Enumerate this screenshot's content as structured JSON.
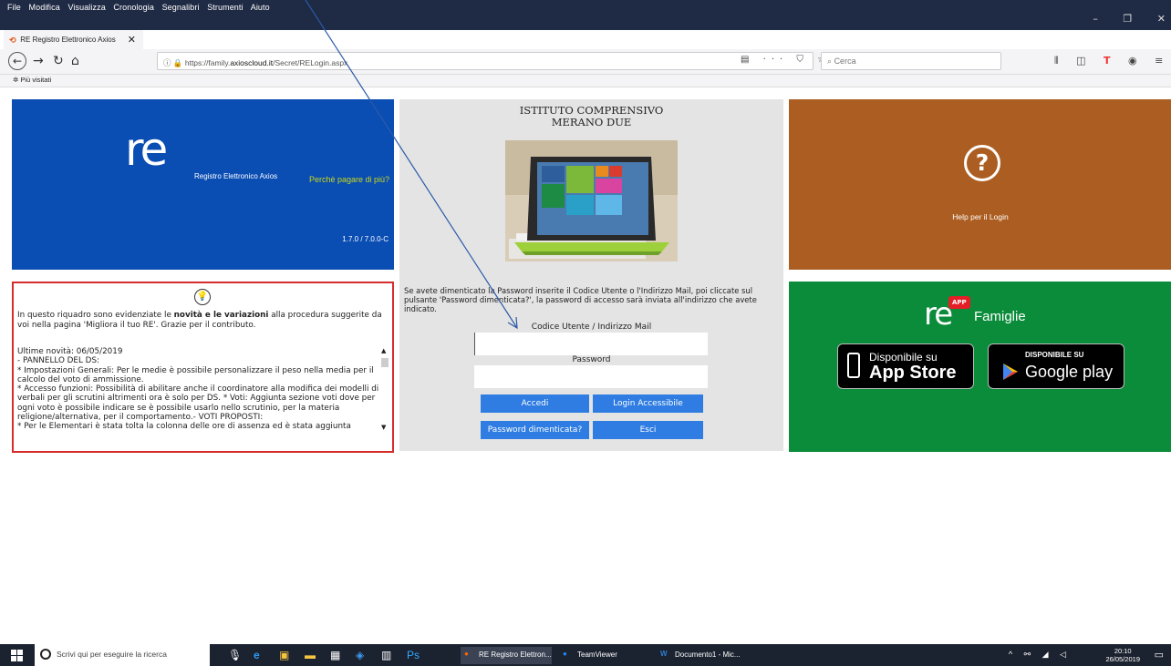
{
  "browser": {
    "menu": [
      "File",
      "Modifica",
      "Visualizza",
      "Cronologia",
      "Segnalibri",
      "Strumenti",
      "Aiuto"
    ],
    "window_controls": [
      "–",
      "❐",
      "✕"
    ],
    "tab_title": "RE Registro Elettronico Axios",
    "url_prefix": "https://family.",
    "url_domain": "axioscloud.it",
    "url_path": "/Secret/RELogin.aspx",
    "search_placeholder": "Cerca",
    "bookmark": "Più visitati"
  },
  "tiles": {
    "registro": {
      "logo": "re",
      "name": "Registro Elettronico Axios",
      "tagline": "Perchè pagare di più?",
      "version": "1.7.0 / 7.0.0-C"
    },
    "school": {
      "line1": "ISTITUTO COMPRENSIVO",
      "line2": "MERANO DUE"
    },
    "login": {
      "forgot_text": "Se avete dimenticato la Password inserite il Codice Utente o l'Indirizzo Mail, poi cliccate sul pulsante 'Password dimenticata?', la password di accesso sarà inviata all'indirizzo che avete indicato.",
      "user_label": "Codice Utente / Indirizzo Mail",
      "user_value": "",
      "password_label": "Password",
      "password_value": "",
      "btn_accedi": "Accedi",
      "btn_accessibile": "Login Accessibile",
      "btn_dimenticata": "Password dimenticata?",
      "btn_esci": "Esci"
    },
    "help": {
      "label": "Help per il Login"
    },
    "news": {
      "intro_pre": "In questo riquadro sono evidenziate le ",
      "intro_bold": "novità e le variazioni",
      "intro_post": " alla procedura suggerite da voi nella pagina 'Migliora il tuo RE'. Grazie per il contributo.",
      "lines": [
        "Ultime novità: 06/05/2019",
        "- PANNELLO DEL DS:",
        "   * Impostazioni Generali: Per le medie è possibile personalizzare il peso nella media per il calcolo del voto di ammissione.",
        "   * Accesso funzioni: Possibilità di abilitare anche il coordinatore alla modifica dei modelli di verbali per gli scrutini altrimenti ora è solo per DS.  * Voti: Aggiunta sezione voti dove per ogni voto è possibile indicare se è possibile usarlo nello scrutinio, per la materia religione/alternativa, per il comportamento.- VOTI PROPOSTI:",
        "   * Per le Elementari è stata tolta la colonna delle ore di assenza ed è stata aggiunta"
      ]
    },
    "famiglie": {
      "logo": "re",
      "app_badge": "APP",
      "name": "Famiglie",
      "appstore_small": "Disponibile su",
      "appstore_big": "App Store",
      "gplay_small": "DISPONIBILE SU",
      "gplay_big": "Google play"
    }
  },
  "taskbar": {
    "search_placeholder": "Scrivi qui per eseguire la ricerca",
    "tasks": [
      "RE Registro Elettron...",
      "TeamViewer",
      "Documento1 - Mic..."
    ],
    "time": "20:10",
    "date": "26/05/2019"
  },
  "colors": {
    "blue_tile": "#0a4db3",
    "help_tile": "#ac5e22",
    "famiglie_tile": "#0b8c3a",
    "button": "#2f7de2",
    "news_border": "#d52c2c"
  }
}
